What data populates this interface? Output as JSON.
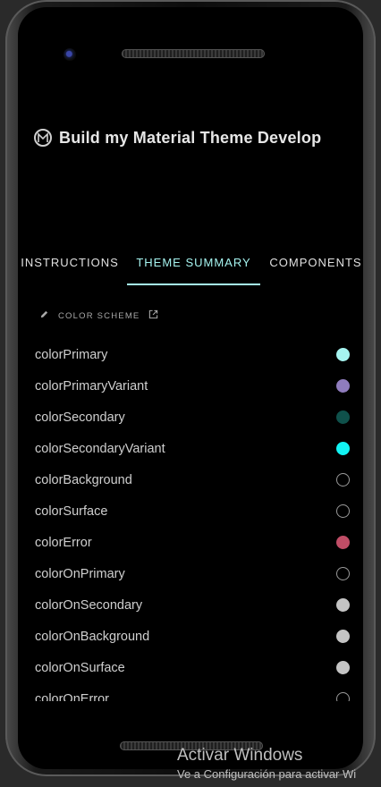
{
  "app": {
    "title": "Build my Material Theme Develop"
  },
  "tabs": [
    {
      "label": "INSTRUCTIONS",
      "active": false
    },
    {
      "label": "THEME SUMMARY",
      "active": true
    },
    {
      "label": "COMPONENTS",
      "active": false
    }
  ],
  "section": {
    "label": "COLOR SCHEME",
    "icon": "pencil-icon",
    "link_icon": "open-in-new-icon"
  },
  "colors": [
    {
      "name": "colorPrimary",
      "swatch": "#a6f4f0"
    },
    {
      "name": "colorPrimaryVariant",
      "swatch": "#8f7cbd"
    },
    {
      "name": "colorSecondary",
      "swatch": "#0f514b"
    },
    {
      "name": "colorSecondaryVariant",
      "swatch": "#12f3f3"
    },
    {
      "name": "colorBackground",
      "swatch": "#000000"
    },
    {
      "name": "colorSurface",
      "swatch": "#000000"
    },
    {
      "name": "colorError",
      "swatch": "#c04d66"
    },
    {
      "name": "colorOnPrimary",
      "swatch": "#000000"
    },
    {
      "name": "colorOnSecondary",
      "swatch": "#c4c4c4"
    },
    {
      "name": "colorOnBackground",
      "swatch": "#c4c4c4"
    },
    {
      "name": "colorOnSurface",
      "swatch": "#c4c4c4"
    },
    {
      "name": "colorOnError",
      "swatch": "#000000"
    }
  ],
  "watermark": {
    "title": "Activar Windows",
    "subtitle": "Ve a Configuración para activar Wi"
  },
  "theme": {
    "accent": "#a6f4f0",
    "background": "#000000"
  }
}
